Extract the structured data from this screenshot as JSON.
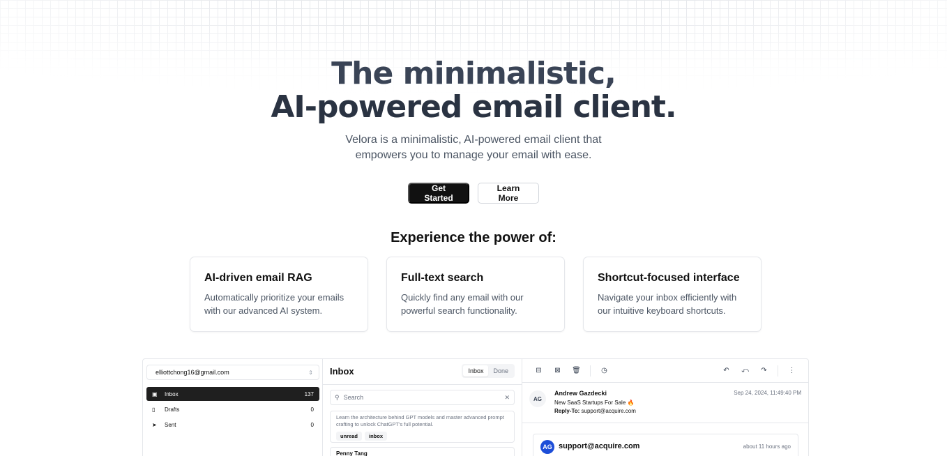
{
  "hero": {
    "title_line1": "The minimalistic,",
    "title_line2": "AI-powered email client.",
    "subtitle_line1": "Velora is a minimalistic, AI-powered email client that",
    "subtitle_line2": "empowers you to manage your email with ease."
  },
  "cta": {
    "primary": "Get Started",
    "secondary": "Learn More"
  },
  "features": {
    "heading": "Experience the power of:",
    "items": [
      {
        "title": "AI-driven email RAG",
        "description": "Automatically prioritize your emails with our advanced AI system."
      },
      {
        "title": "Full-text search",
        "description": "Quickly find any email with our powerful search functionality."
      },
      {
        "title": "Shortcut-focused interface",
        "description": "Navigate your inbox efficiently with our intuitive keyboard shortcuts."
      }
    ]
  },
  "app": {
    "account": "elliottchong16@gmail.com",
    "nav": [
      {
        "label": "Inbox",
        "count": "137",
        "icon": "inbox-icon"
      },
      {
        "label": "Drafts",
        "count": "0",
        "icon": "file-icon"
      },
      {
        "label": "Sent",
        "count": "0",
        "icon": "send-icon"
      }
    ],
    "list": {
      "title": "Inbox",
      "tabs": [
        "Inbox",
        "Done"
      ],
      "search_placeholder": "Search",
      "preview_text": "Learn the architecture behind GPT models and master advanced prompt crafting to unlock ChatGPT's full potential.",
      "tags": [
        "unread",
        "inbox"
      ],
      "next_sender": "Penny Tang"
    },
    "reader": {
      "avatar_initials": "AG",
      "from": "Andrew Gazdecki",
      "subject": "New SaaS Startups For Sale 🔥",
      "reply_to_label": "Reply-To:",
      "reply_to": "support@acquire.com",
      "date": "Sep 24, 2024, 11:49:40 PM",
      "thread_avatar": "AG",
      "thread_from": "support@acquire.com",
      "thread_time": "about 11 hours ago"
    }
  }
}
